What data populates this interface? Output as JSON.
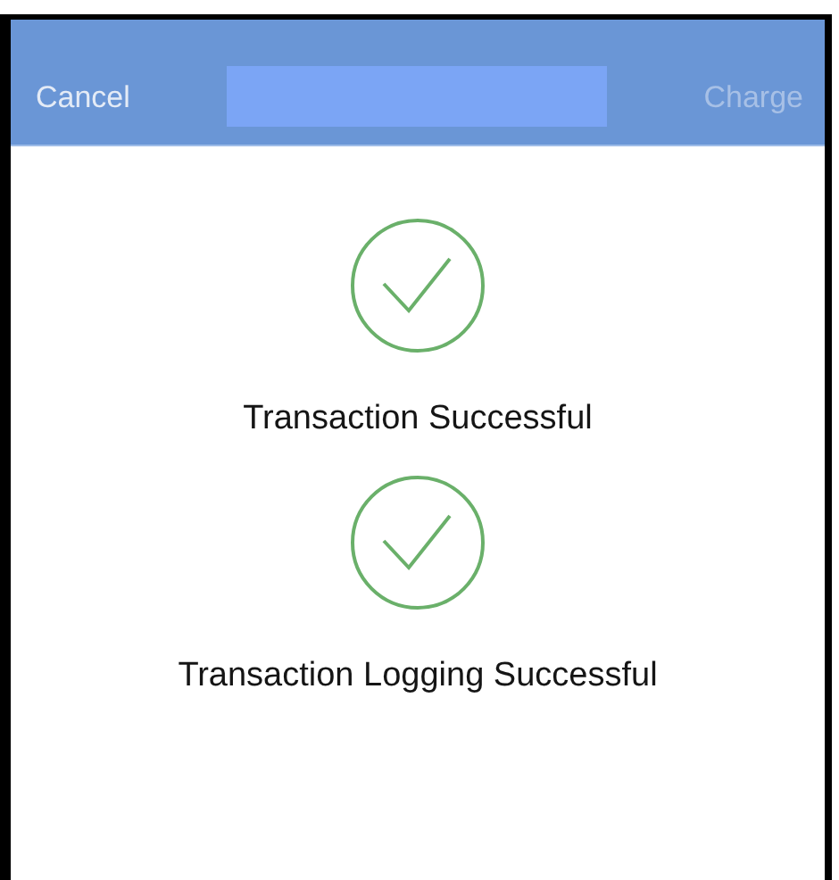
{
  "nav_bar": {
    "left_button": {
      "label": "Cancel",
      "disabled": false
    },
    "right_button": {
      "label": "Charge",
      "disabled": true
    }
  },
  "results": [
    {
      "kind": "success",
      "label": "Transaction Successful"
    },
    {
      "kind": "success",
      "label": "Transaction Logging Successful"
    }
  ]
}
